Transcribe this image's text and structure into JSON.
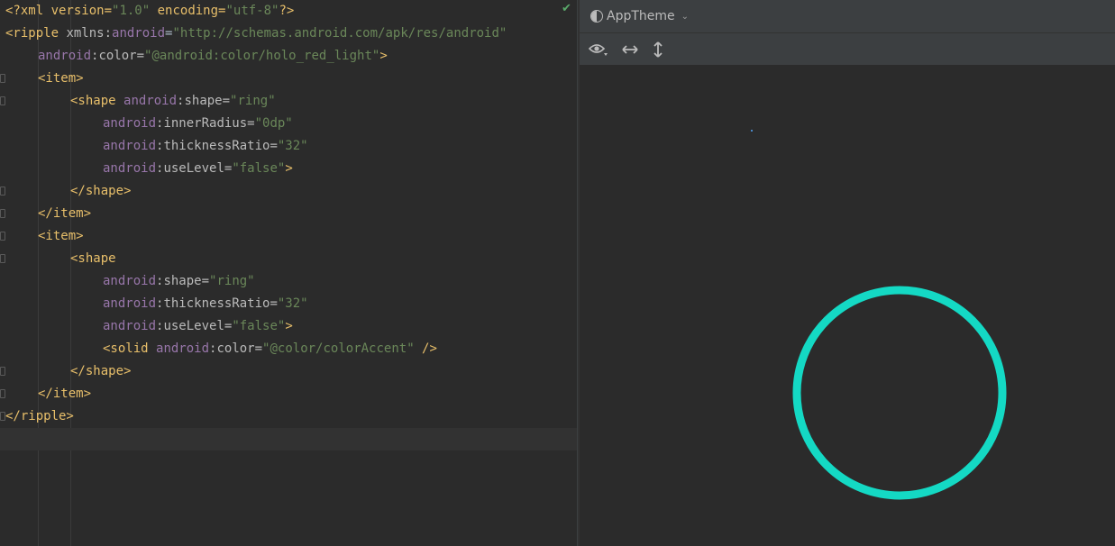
{
  "editor": {
    "lines": [
      [
        "<?xml version=",
        "\"1.0\"",
        " encoding=",
        "\"utf-8\"",
        "?>"
      ],
      [
        "<ripple ",
        "xmlns:",
        "android",
        "=",
        "\"http://schemas.android.com/apk/res/android\""
      ],
      [
        "android",
        ":color=",
        "\"@android:color/holo_red_light\"",
        ">"
      ],
      [
        "<item>"
      ],
      [
        "<shape ",
        "android",
        ":shape=",
        "\"ring\""
      ],
      [
        "android",
        ":innerRadius=",
        "\"0dp\""
      ],
      [
        "android",
        ":thicknessRatio=",
        "\"32\""
      ],
      [
        "android",
        ":useLevel=",
        "\"false\"",
        ">"
      ],
      [
        "</shape>"
      ],
      [
        "</item>"
      ],
      [
        "<item>"
      ],
      [
        "<shape"
      ],
      [
        "android",
        ":shape=",
        "\"ring\""
      ],
      [
        "android",
        ":thicknessRatio=",
        "\"32\""
      ],
      [
        "android",
        ":useLevel=",
        "\"false\"",
        ">"
      ],
      [
        "<solid ",
        "android",
        ":color=",
        "\"@color/colorAccent\"",
        " />"
      ],
      [
        "</shape>"
      ],
      [
        "</item>"
      ],
      [
        "</ripple>"
      ]
    ]
  },
  "preview": {
    "theme_label": "AppTheme",
    "ring_color": "#14d9c4"
  },
  "icons": {
    "eye": "eye-icon",
    "horizontal": "resize-horizontal-icon",
    "vertical": "resize-vertical-icon"
  }
}
